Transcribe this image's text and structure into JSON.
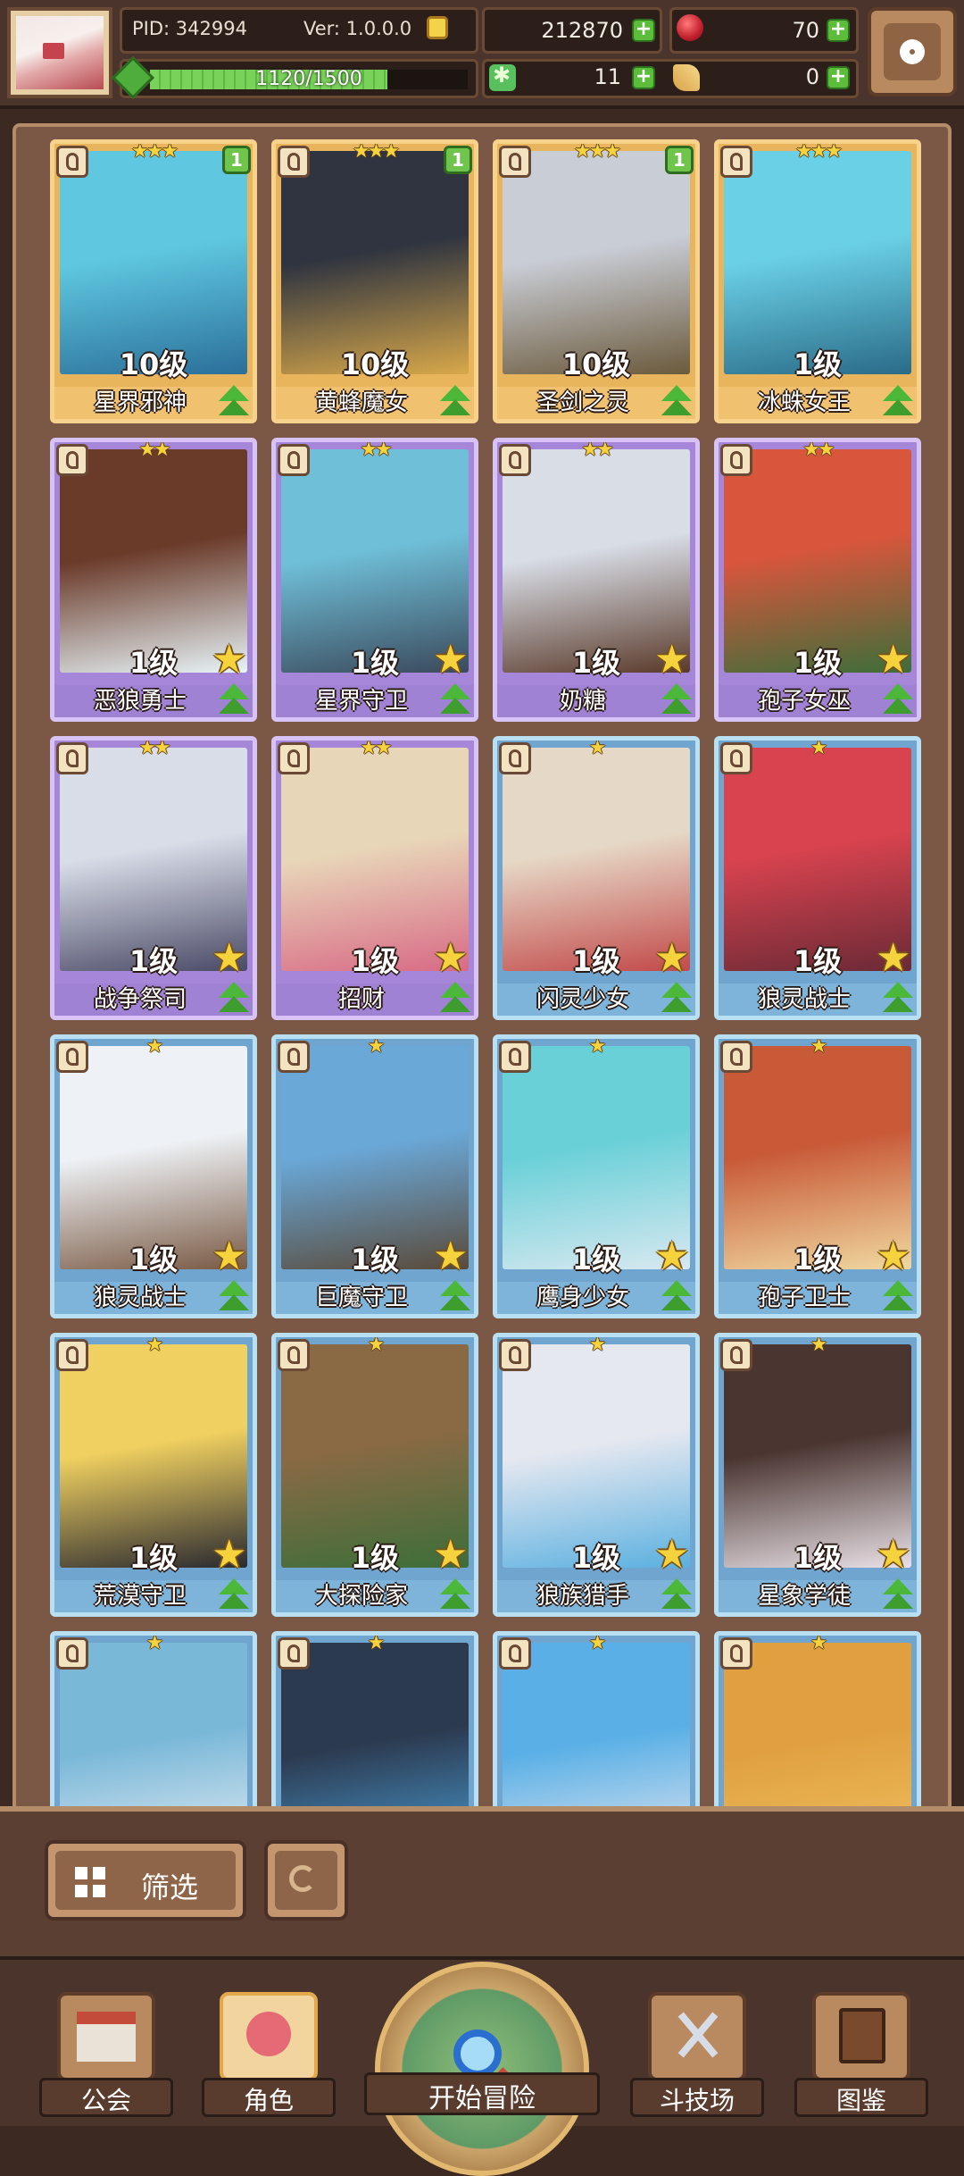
{
  "header": {
    "pid": "PID: 342994",
    "version": "Ver: 1.0.0.0",
    "coins": "212870",
    "gems": "70",
    "exp_text": "1120/1500",
    "exp_fraction": 0.7467,
    "clover": "11",
    "feather": "0"
  },
  "heroes": [
    {
      "name": "星界邪神",
      "level": "10级",
      "rarity": "gold",
      "stars": "★★★",
      "badge": "1"
    },
    {
      "name": "黄蜂魔女",
      "level": "10级",
      "rarity": "gold",
      "stars": "★★★",
      "badge": "1"
    },
    {
      "name": "圣剑之灵",
      "level": "10级",
      "rarity": "gold",
      "stars": "★★★",
      "badge": "1"
    },
    {
      "name": "冰蛛女王",
      "level": "1级",
      "rarity": "gold",
      "stars": "★★★",
      "badge": ""
    },
    {
      "name": "恶狼勇士",
      "level": "1级",
      "rarity": "purple",
      "stars": "★★",
      "badge": ""
    },
    {
      "name": "星界守卫",
      "level": "1级",
      "rarity": "purple",
      "stars": "★★",
      "badge": ""
    },
    {
      "name": "奶糖",
      "level": "1级",
      "rarity": "purple",
      "stars": "★★",
      "badge": ""
    },
    {
      "name": "孢子女巫",
      "level": "1级",
      "rarity": "purple",
      "stars": "★★",
      "badge": ""
    },
    {
      "name": "战争祭司",
      "level": "1级",
      "rarity": "purple",
      "stars": "★★",
      "badge": ""
    },
    {
      "name": "招财",
      "level": "1级",
      "rarity": "purple",
      "stars": "★★",
      "badge": ""
    },
    {
      "name": "闪灵少女",
      "level": "1级",
      "rarity": "blue",
      "stars": "★",
      "badge": ""
    },
    {
      "name": "狼灵战士",
      "level": "1级",
      "rarity": "blue",
      "stars": "★",
      "badge": ""
    },
    {
      "name": "狼灵战士",
      "level": "1级",
      "rarity": "blue",
      "stars": "★",
      "badge": ""
    },
    {
      "name": "巨魔守卫",
      "level": "1级",
      "rarity": "blue",
      "stars": "★",
      "badge": ""
    },
    {
      "name": "鹰身少女",
      "level": "1级",
      "rarity": "blue",
      "stars": "★",
      "badge": ""
    },
    {
      "name": "孢子卫士",
      "level": "1级",
      "rarity": "blue",
      "stars": "★",
      "badge": ""
    },
    {
      "name": "荒漠守卫",
      "level": "1级",
      "rarity": "blue",
      "stars": "★",
      "badge": ""
    },
    {
      "name": "大探险家",
      "level": "1级",
      "rarity": "blue",
      "stars": "★",
      "badge": ""
    },
    {
      "name": "狼族猎手",
      "level": "1级",
      "rarity": "blue",
      "stars": "★",
      "badge": ""
    },
    {
      "name": "星象学徒",
      "level": "1级",
      "rarity": "blue",
      "stars": "★",
      "badge": ""
    },
    {
      "name": "",
      "level": "",
      "rarity": "blue",
      "stars": "★",
      "badge": ""
    },
    {
      "name": "",
      "level": "",
      "rarity": "blue",
      "stars": "★",
      "badge": ""
    },
    {
      "name": "",
      "level": "",
      "rarity": "blue",
      "stars": "★",
      "badge": ""
    },
    {
      "name": "",
      "level": "",
      "rarity": "blue",
      "stars": "★",
      "badge": ""
    }
  ],
  "portrait_colors": [
    [
      "#5fc8e0",
      "#2b6f9a"
    ],
    [
      "#2f3440",
      "#d8a84a"
    ],
    [
      "#c9cdd6",
      "#6b5a3c"
    ],
    [
      "#6ad0e6",
      "#2a6b88"
    ],
    [
      "#6b3b2a",
      "#e8f4f8"
    ],
    [
      "#6fbfd8",
      "#3b4a5c"
    ],
    [
      "#d8dde6",
      "#5a3a2a"
    ],
    [
      "#d8563c",
      "#3d6e3a"
    ],
    [
      "#d9dde8",
      "#4a4a66"
    ],
    [
      "#e8d6b8",
      "#d86a86"
    ],
    [
      "#e6d8c6",
      "#c24a4a"
    ],
    [
      "#d8434f",
      "#6a2a36"
    ],
    [
      "#eef2f6",
      "#7a5a44"
    ],
    [
      "#6aa8d8",
      "#5a4a3a"
    ],
    [
      "#6ad0d8",
      "#d8e8f0"
    ],
    [
      "#c85a38",
      "#f0d8a0"
    ],
    [
      "#f0d060",
      "#2a2a30"
    ],
    [
      "#8a6a44",
      "#3d6e3a"
    ],
    [
      "#e6e8f0",
      "#5ab0e0"
    ],
    [
      "#4a3530",
      "#e8e0e6"
    ],
    [
      "#7ab8d8",
      "#e8eef4"
    ],
    [
      "#2c3a50",
      "#4aa0d8"
    ],
    [
      "#5ab0e6",
      "#e8e8f0"
    ],
    [
      "#e0a040",
      "#f0c060"
    ]
  ],
  "controls": {
    "filter_label": "筛选"
  },
  "nav": {
    "guild": "公会",
    "characters": "角色",
    "adventure": "开始冒险",
    "arena": "斗技场",
    "codex": "图鉴"
  }
}
